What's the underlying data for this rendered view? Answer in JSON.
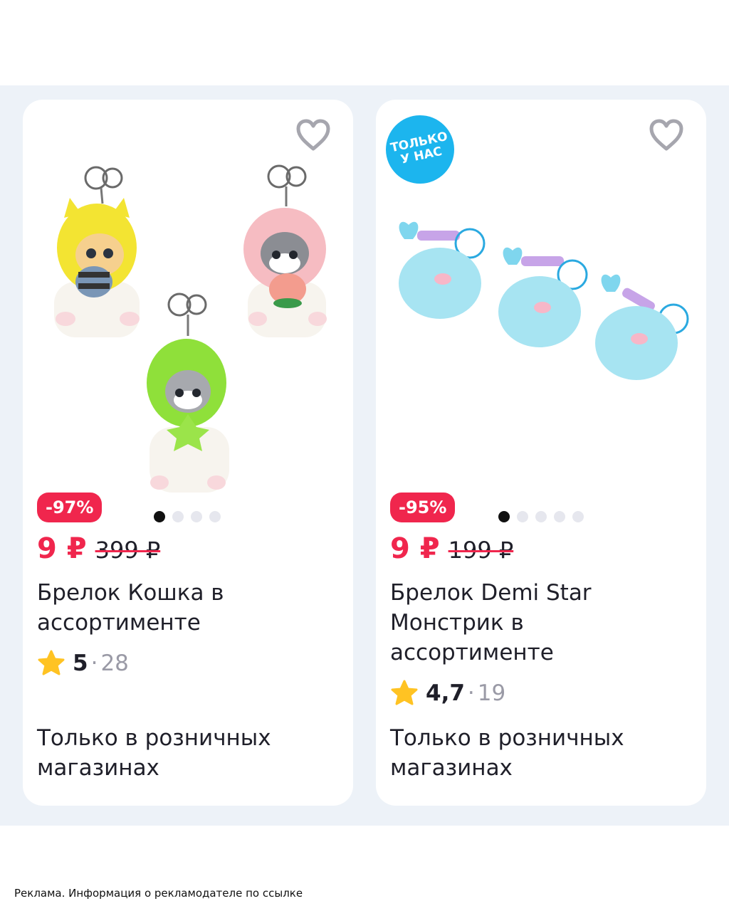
{
  "products": [
    {
      "discount": "-97%",
      "price": "9 ₽",
      "old_price": "399 ₽",
      "title": "Брелок Кошка в ассортименте",
      "rating": "5",
      "reviews": "28",
      "availability": "Только в розничных магазинах",
      "image_dots": 4,
      "active_dot": 1,
      "icon": "heart-outline-icon"
    },
    {
      "badge": "ТОЛЬКО\nУ НАС",
      "discount": "-95%",
      "price": "9 ₽",
      "old_price": "199 ₽",
      "title": "Брелок Demi Star Монстрик в ассортименте",
      "rating": "4,7",
      "reviews": "19",
      "availability": "Только в розничных магазинах",
      "image_dots": 5,
      "active_dot": 1,
      "icon": "heart-outline-icon"
    }
  ],
  "ad_note": "Реклама. Информация о рекламодателе по ссылке",
  "colors": {
    "accent_red": "#f0264d",
    "exclusive_badge_blue": "#1cb5ee",
    "background": "#edf2f8",
    "star": "#ffc323"
  }
}
